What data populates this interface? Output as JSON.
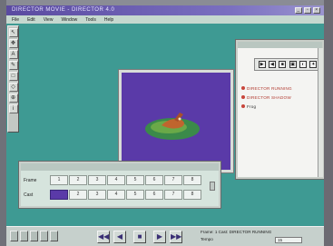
{
  "window": {
    "title": "DIRECTOR MOVIE - DIRECTOR 4.0",
    "minimize_glyph": "_",
    "maximize_glyph": "▫",
    "close_glyph": "×"
  },
  "menu": [
    "File",
    "Edit",
    "View",
    "Window",
    "Tools",
    "Help"
  ],
  "toolbar": {
    "tools": [
      {
        "name": "arrow-tool-icon",
        "glyph": "↖"
      },
      {
        "name": "move-tool-icon",
        "glyph": "✥"
      },
      {
        "name": "text-tool-icon",
        "glyph": "A"
      },
      {
        "name": "paint-tool-icon",
        "glyph": "✎"
      },
      {
        "name": "shape-tool-icon",
        "glyph": "□"
      },
      {
        "name": "cast-tool-icon",
        "glyph": "◇"
      },
      {
        "name": "zoom-tool-icon",
        "glyph": "⊕"
      },
      {
        "name": "info-tool-icon",
        "glyph": "i"
      }
    ]
  },
  "cast_window": {
    "icons": [
      "▶",
      "◀",
      "■",
      "▣",
      "◐",
      "✦"
    ],
    "items": [
      {
        "label": "DIRECTOR RUNNING",
        "highlight": true
      },
      {
        "label": "DIRECTOR SHADOW",
        "highlight": true
      },
      {
        "label": "Frog",
        "highlight": false
      }
    ]
  },
  "channels": {
    "row1_label": "Frame",
    "row2_label": "Cast",
    "numbers": [
      "1",
      "2",
      "3",
      "4",
      "5",
      "6",
      "7",
      "8"
    ]
  },
  "controlbar": {
    "rewind": "◀◀",
    "step_back": "◀",
    "stop": "■",
    "play": "▶",
    "step_fwd": "▶▶",
    "status_line1": "Frame: 1  Cast: DIRECTOR RUNNING",
    "status_line2": "Tempo",
    "tempo_value": "15"
  },
  "colors": {
    "desktop": "#3e9a93",
    "stage": "#5a3aa8",
    "accent": "#5a4aa0"
  }
}
